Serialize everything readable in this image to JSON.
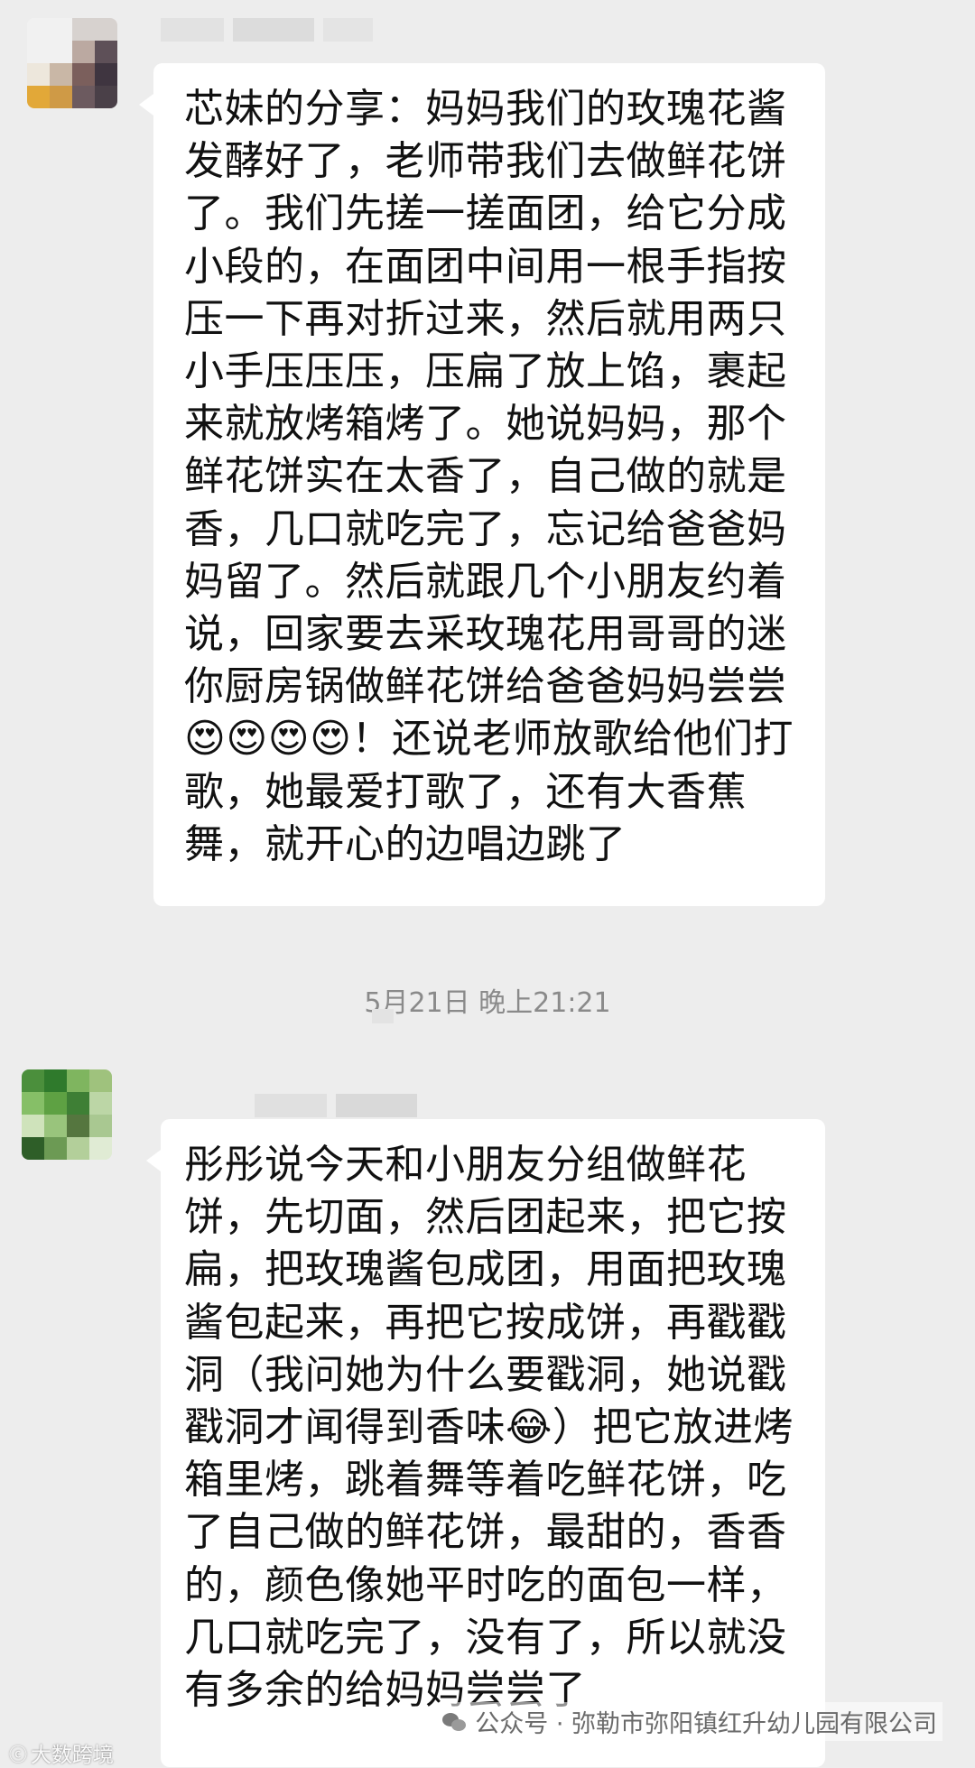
{
  "messages": [
    {
      "text": "芯妹的分享：妈妈我们的玫瑰花酱发酵好了，老师带我们去做鲜花饼了。我们先搓一搓面团，给它分成小段的，在面团中间用一根手指按压一下再对折过来，然后就用两只小手压压压，压扁了放上馅，裹起来就放烤箱烤了。她说妈妈，那个鲜花饼实在太香了，自己做的就是香，几口就吃完了，忘记给爸爸妈妈留了。然后就跟几个小朋友约着说，回家要去采玫瑰花用哥哥的迷你厨房锅做鲜花饼给爸爸妈妈尝尝😍😍😍😍！还说老师放歌给他们打歌，她最爱打歌了，还有大香蕉舞，就开心的边唱边跳了"
    },
    {
      "text": "彤彤说今天和小朋友分组做鲜花饼，先切面，然后团起来，把它按扁，把玫瑰酱包成团，用面把玫瑰酱包起来，再把它按成饼，再戳戳洞（我问她为什么要戳洞，她说戳戳洞才闻得到香味😂）把它放进烤箱里烤，跳着舞等着吃鲜花饼，吃了自己做的鲜花饼，最甜的，香香的，颜色像她平时吃的面包一样，几口就吃完了，没有了，所以就没有多余的给妈妈尝尝了"
    }
  ],
  "timestamp": "5月21日 晚上21:21",
  "watermark": {
    "left": "大数跨境",
    "right": "公众号 · 弥勒市弥阳镇红升幼儿园有限公司"
  },
  "colors": {
    "background": "#ededed",
    "bubble": "#ffffff",
    "timestamp_text": "#8a8a8a"
  }
}
